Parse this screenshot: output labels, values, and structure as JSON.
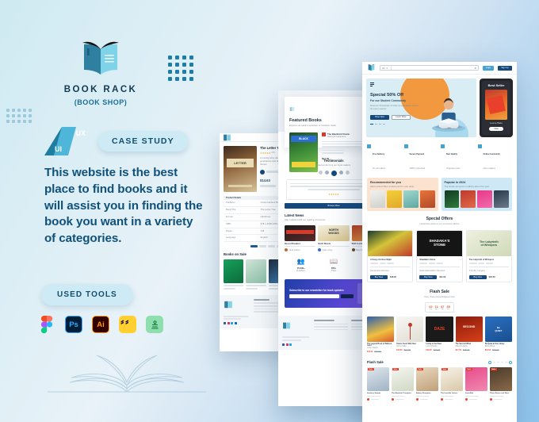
{
  "brand": {
    "name": "BOOK RACK",
    "subtitle": "(BOOK SHOP)",
    "logo_icon": "open-book-icon"
  },
  "badges": {
    "discipline_ux": "UX",
    "discipline_ui": "UI",
    "case_study": "CASE STUDY"
  },
  "headline": "This website is the best place to find books and it will assist you in finding the book you want in a variety of categories.",
  "tools": {
    "label": "USED TOOLS",
    "items": [
      {
        "name": "Figma",
        "icon": "figma-icon",
        "glyph": "",
        "bg": "#ffffff",
        "fg": "#f24e1e"
      },
      {
        "name": "Adobe Photoshop",
        "icon": "photoshop-icon",
        "glyph": "Ps",
        "bg": "#001e36",
        "fg": "#31a8ff"
      },
      {
        "name": "Adobe Illustrator",
        "icon": "illustrator-icon",
        "glyph": "Ai",
        "bg": "#330000",
        "fg": "#ff9a00"
      },
      {
        "name": "Miro",
        "icon": "miro-icon",
        "glyph": "m",
        "bg": "#ffd02f",
        "fg": "#050038"
      },
      {
        "name": "Mockup Tool",
        "icon": "green-app-icon",
        "glyph": "",
        "bg": "#8fdeae",
        "fg": "#117a3d"
      }
    ]
  },
  "colors": {
    "brand_dark": "#10517a",
    "brand_mid": "#1b6e95",
    "pill_bg": "#cdeaf5",
    "accent_orange": "#f2993f",
    "sale_red": "#e8402a",
    "button_blue": "#15497e"
  },
  "decor": {
    "dot_grid_main": "dot-grid-decoration",
    "dot_grid_small": "dot-grid-decoration-small",
    "line_art": "open-book-line-art"
  },
  "mockups": {
    "right_screen": {
      "name": "Home Page",
      "header": {
        "search_placeholder": "All",
        "login_label": "Login",
        "signup_label": "Sign Up"
      },
      "hero": {
        "title": "Special 50%  Off",
        "subtitle": "For our Student Community",
        "body": "Discover thousands of titles at unbeatable prices for every learner.",
        "primary_cta": "Shop Now",
        "secondary_cta": "Learn More"
      },
      "best_seller": {
        "label": "Best Seller",
        "author": "Leanne Blake",
        "cta": "View"
      },
      "features": [
        {
          "title": "Free Delivery",
          "desc": "On all orders"
        },
        {
          "title": "Secure Payment",
          "desc": "100% protected"
        },
        {
          "title": "Best Quality",
          "desc": "Original prints"
        },
        {
          "title": "Online Community",
          "desc": "Join readers"
        }
      ],
      "promos": [
        {
          "title": "Recommended for you",
          "desc": "Hand picked titles curated just for your taste.",
          "cta": "Browse"
        },
        {
          "title": "Popular in 2024",
          "desc": "The books everyone is talking about this year.",
          "cta": "Browse"
        }
      ],
      "special_offers": {
        "title": "Special Offers",
        "subtitle": "Limited time deals on our most loved editions",
        "cards": [
          {
            "title": "A Song of Ashes Night",
            "author": "Samantha Atkinson",
            "cta": "Buy Now",
            "price": "$18.00"
          },
          {
            "title": "Shadaka's Stone",
            "author": "Katie Maxwellton Serrano",
            "cta": "Buy Now",
            "price": "$21.00"
          },
          {
            "title": "The Labyrinth of Whispers",
            "author": "Timothy Langley",
            "cta": "Buy Now",
            "price": "$16.50"
          }
        ]
      },
      "flash_sale": {
        "title": "Flash Sale",
        "subtitle": "Hurry, these prices disappear soon",
        "timer": [
          {
            "value": "02",
            "unit": "Day"
          },
          {
            "value": "11",
            "unit": "Hrs"
          },
          {
            "value": "47",
            "unit": "Min"
          },
          {
            "value": "35",
            "unit": "Sec"
          }
        ],
        "items": [
          {
            "title": "The Legend Book of Balloon Land",
            "author": "John Reed",
            "price": "$14.00",
            "old_price": "$22.00"
          },
          {
            "title": "Poetic Fresh With Red",
            "author": "Anna Vale",
            "price": "$12.50",
            "old_price": "$19.00"
          },
          {
            "title": "Living in the Daze",
            "author": "Leon Parks",
            "price": "$16.00",
            "old_price": "$24.00"
          },
          {
            "title": "The Second Wind",
            "author": "Marcus Ellis",
            "price": "$17.00",
            "old_price": "$26.00"
          },
          {
            "title": "Be Quiet at the Library",
            "author": "Rita Moss",
            "price": "$13.00",
            "old_price": "$20.00"
          }
        ]
      },
      "flash_sale_strip": {
        "title": "Flash Sale",
        "items": [
          {
            "title": "Sunbury Sample",
            "badge": "Sale"
          },
          {
            "title": "The Absolute Principles",
            "badge": "Sale"
          },
          {
            "title": "Bakery Deception",
            "badge": "Sale"
          },
          {
            "title": "The Invisible Letters",
            "badge": "Sale"
          },
          {
            "title": "Incredible",
            "badge": "Sale"
          },
          {
            "title": "Those Bones and Stars",
            "badge": "Sale"
          }
        ]
      }
    },
    "mid_screen": {
      "name": "Featured Books Page",
      "featured": {
        "title": "Featured Books",
        "subtitle": "Explore our editor's selection of standout reads",
        "card": {
          "title": "The Blackbird Oracle",
          "author": "Deborah Harkness",
          "price": "$24.99",
          "cta": "Add to Cart"
        }
      },
      "testimonials": {
        "title": "Testimonials"
      },
      "latest_news": {
        "title": "Latest News",
        "subtitle": "Stay updated with our reading community",
        "articles": [
          {
            "title": "Record Breakers",
            "author": "Jess Carter",
            "date": "12 May 2024"
          },
          {
            "title": "North Woods",
            "author": "Liam Grey",
            "date": "08 May 2024"
          },
          {
            "title": "Wild Cocktail",
            "author": "Nina Patel",
            "date": "02 May 2024"
          }
        ]
      },
      "stats": [
        {
          "value": "15,000+",
          "label": "Readers"
        },
        {
          "value": "780+",
          "label": "Titles"
        },
        {
          "value": "120+",
          "label": "Events"
        }
      ],
      "newsletter": {
        "title": "Subscribe to our newsletter for book updates",
        "cta": "Subscribe"
      }
    },
    "left_screen": {
      "name": "Product Detail Page",
      "product": {
        "title": "The Letter Tree",
        "rating": "4.6",
        "reviews": "128 reviews",
        "price": "$14.63",
        "old_price": "$21.00",
        "cta": "Add to Cart"
      },
      "details_table": {
        "header": [
          "Product Details",
          ""
        ],
        "rows": [
          [
            "Publisher",
            "Crown Harbour Books"
          ],
          [
            "Book Title",
            "The Letter Tree"
          ],
          [
            "Format",
            "Hardcover"
          ],
          [
            "ISBN",
            "978-1-4028-9462-1"
          ],
          [
            "Pages",
            "348"
          ],
          [
            "Language",
            "English"
          ]
        ]
      },
      "books_on_sale": {
        "title": "Books on Sale"
      },
      "footer": {
        "brand": "BOOK RACK"
      }
    }
  }
}
